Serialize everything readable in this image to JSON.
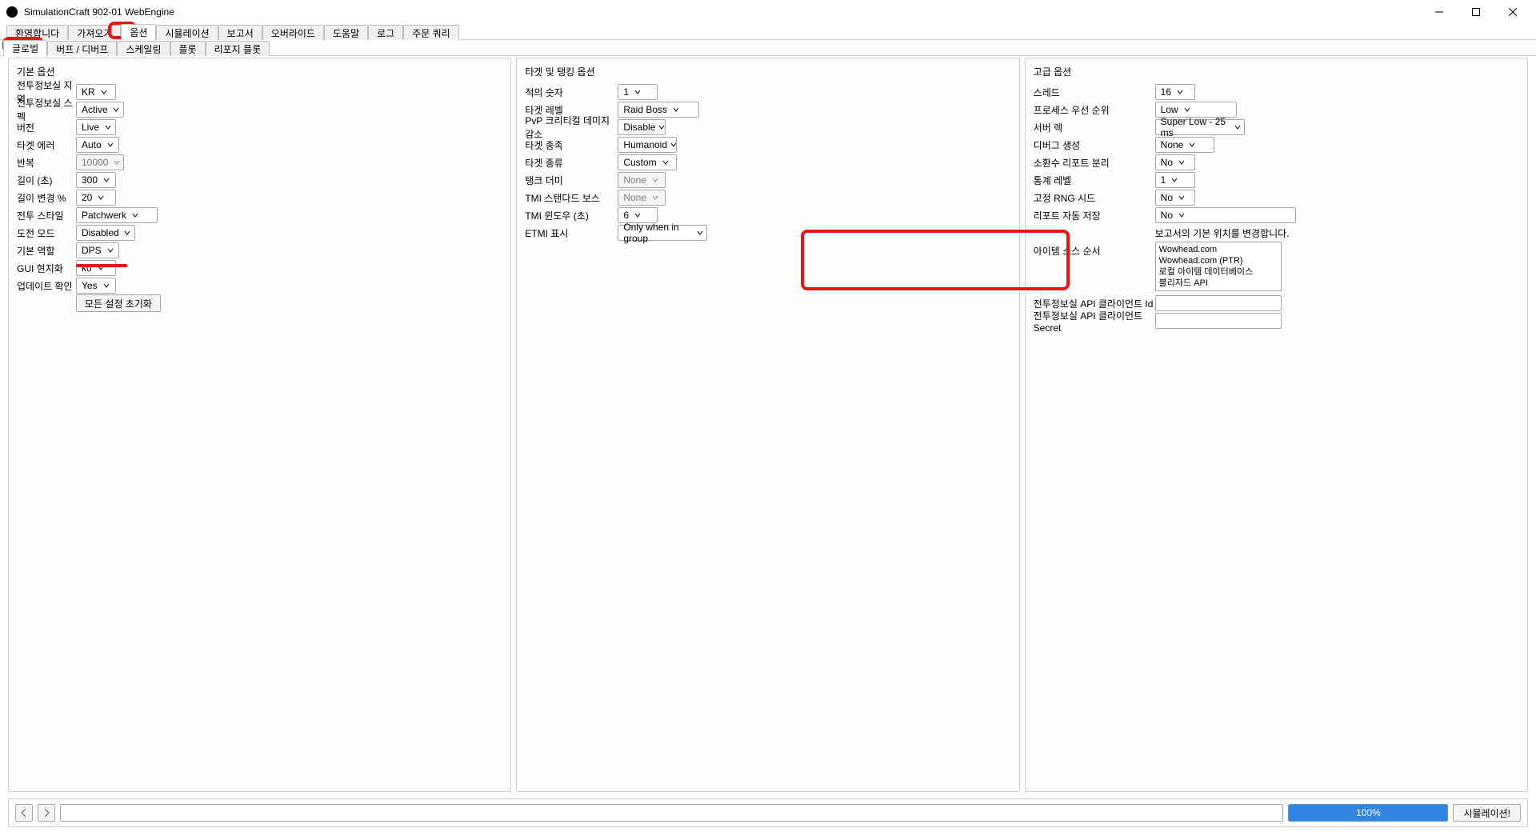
{
  "window": {
    "title": "SimulationCraft 902-01 WebEngine"
  },
  "main_tabs": [
    "환영합니다",
    "가져오기",
    "옵션",
    "시뮬레이션",
    "보고서",
    "오버라이드",
    "도움말",
    "로그",
    "주문 쿼리"
  ],
  "main_tabs_active_index": 2,
  "sub_tabs": [
    "글로벌",
    "버프 / 디버프",
    "스케일링",
    "플롯",
    "리포지 플롯"
  ],
  "sub_tabs_active_index": 0,
  "left": {
    "title": "기본 옵션",
    "armory_region": {
      "label": "전투정보실 지역",
      "value": "KR"
    },
    "armory_spec": {
      "label": "전투정보실 스펙",
      "value": "Active"
    },
    "version": {
      "label": "버전",
      "value": "Live"
    },
    "target_error": {
      "label": "타겟 에러",
      "value": "Auto"
    },
    "iterations": {
      "label": "반복",
      "value": "10000"
    },
    "length": {
      "label": "길이 (초)",
      "value": "300"
    },
    "length_var": {
      "label": "길이 변경 %",
      "value": "20"
    },
    "fight_style": {
      "label": "전투 스타일",
      "value": "Patchwerk"
    },
    "challenge": {
      "label": "도전 모드",
      "value": "Disabled"
    },
    "default_role": {
      "label": "기본 역할",
      "value": "DPS"
    },
    "gui_locale": {
      "label": "GUI 현지화",
      "value": "ko"
    },
    "update_check": {
      "label": "업데이트 확인",
      "value": "Yes"
    },
    "reset_button": "모든 설정 초기화"
  },
  "mid": {
    "title": "타겟 및 탱킹 옵션",
    "enemies": {
      "label": "적의 숫자",
      "value": "1"
    },
    "target_lvl": {
      "label": "타겟 레벨",
      "value": "Raid Boss"
    },
    "pvp_crit": {
      "label": "PvP 크리티컬 데미지 감소",
      "value": "Disable"
    },
    "target_race": {
      "label": "타겟 종족",
      "value": "Humanoid"
    },
    "target_type": {
      "label": "타겟 종류",
      "value": "Custom"
    },
    "tank_dummy": {
      "label": "탱크 더미",
      "value": "None"
    },
    "tmi_boss": {
      "label": "TMI 스탠다드 보스",
      "value": "None"
    },
    "tmi_window": {
      "label": "TMI 윈도우 (초)",
      "value": "6"
    },
    "etmi": {
      "label": "ETMI 표시",
      "value": "Only when in group"
    }
  },
  "right": {
    "title": "고급 옵션",
    "threads": {
      "label": "스레드",
      "value": "16"
    },
    "priority": {
      "label": "프로세스 우선 순위",
      "value": "Low"
    },
    "latency": {
      "label": "서버 렉",
      "value": "Super Low - 25 ms"
    },
    "debug": {
      "label": "디버그 생성",
      "value": "None"
    },
    "pet_report": {
      "label": "소환수 리포트 분리",
      "value": "No"
    },
    "stat_level": {
      "label": "통계 레벨",
      "value": "1"
    },
    "fixed_rng": {
      "label": "고정 RNG 시드",
      "value": "No"
    },
    "autosave": {
      "label": "리포트 자동 저장",
      "value": "No"
    },
    "report_loc": {
      "label": "",
      "text": "보고서의 기본 위치를 변경합니다."
    },
    "item_src": {
      "label": "아이템 소스 순서",
      "items": [
        "Wowhead.com",
        "Wowhead.com (PTR)",
        "로컬 아이템 데이터베이스",
        "블리자드 API"
      ]
    },
    "api_id": {
      "label": "전투정보실 API 클라이언트 Id",
      "value": ""
    },
    "api_secret": {
      "label": "전투정보실 API 클라이언트 Secret",
      "value": ""
    }
  },
  "bottom": {
    "progress_text": "100%",
    "run_button": "시뮬레이션!"
  }
}
